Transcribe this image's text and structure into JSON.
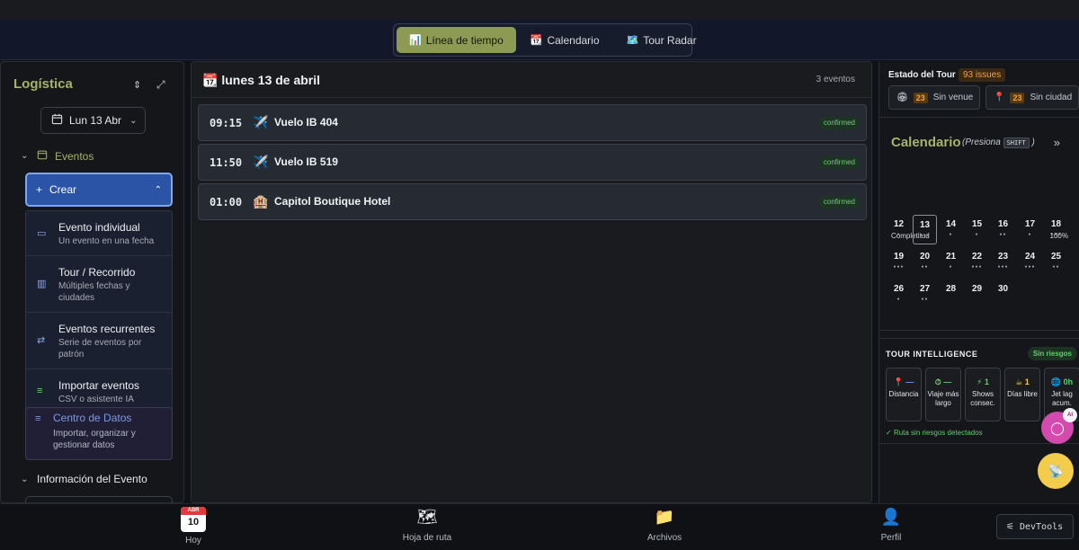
{
  "tabs": [
    {
      "icon": "📊",
      "label": "Línea de tiempo",
      "active": true
    },
    {
      "icon": "📆",
      "label": "Calendario",
      "active": false
    },
    {
      "icon": "🗺️",
      "label": "Tour Radar",
      "active": false
    }
  ],
  "left": {
    "title": "Logística",
    "date_label": "Lun 13 Abr",
    "events_section": "Eventos",
    "create_label": "Crear",
    "create_options": [
      {
        "label": "Evento individual",
        "desc": "Un evento en una fecha"
      },
      {
        "label": "Tour / Recorrido",
        "desc": "Múltiples fechas y ciudades"
      },
      {
        "label": "Eventos recurrentes",
        "desc": "Serie de eventos por patrón"
      },
      {
        "label": "Importar eventos",
        "desc": "CSV o asistente IA"
      }
    ],
    "data_center": {
      "label": "Centro de Datos",
      "desc": "Importar, organizar y gestionar datos"
    },
    "info_section": "Información del Evento"
  },
  "center": {
    "title": "📆 lunes 13 de abril",
    "count": "3 eventos",
    "events": [
      {
        "time": "09:15",
        "icon": "✈️",
        "name": "Vuelo IB 404",
        "status": "confirmed"
      },
      {
        "time": "11:50",
        "icon": "✈️",
        "name": "Vuelo IB 519",
        "status": "confirmed"
      },
      {
        "time": "01:00",
        "icon": "🏨",
        "name": "Capitol Boutique Hotel",
        "status": "confirmed"
      }
    ]
  },
  "right": {
    "estado_label": "Estado del Tour",
    "issues": "93 issues",
    "missing": [
      {
        "icon": "🏟",
        "count": "23",
        "label": "Sin venue"
      },
      {
        "icon": "📍",
        "count": "23",
        "label": "Sin ciudad"
      }
    ],
    "calendar": {
      "title": "Calendario",
      "hint_pre": "(Presiona",
      "hint_key": "SHIFT",
      "hint_post": ")",
      "completion_label": "Completitud",
      "completion_pct": "100%",
      "days": [
        {
          "n": "12",
          "dots": 1
        },
        {
          "n": "13",
          "dots": 3,
          "today": true
        },
        {
          "n": "14",
          "dots": 1
        },
        {
          "n": "15",
          "dots": 1
        },
        {
          "n": "16",
          "dots": 2
        },
        {
          "n": "17",
          "dots": 1
        },
        {
          "n": "18",
          "dots": 3
        },
        {
          "n": "19",
          "dots": 3
        },
        {
          "n": "20",
          "dots": 2
        },
        {
          "n": "21",
          "dots": 1
        },
        {
          "n": "22",
          "dots": 3
        },
        {
          "n": "23",
          "dots": 3
        },
        {
          "n": "24",
          "dots": 3
        },
        {
          "n": "25",
          "dots": 2
        },
        {
          "n": "26",
          "dots": 1
        },
        {
          "n": "27",
          "dots": 2
        },
        {
          "n": "28",
          "dots": 0
        },
        {
          "n": "29",
          "dots": 0
        },
        {
          "n": "30",
          "dots": 0
        }
      ]
    },
    "intel": {
      "title": "TOUR INTELLIGENCE",
      "badge": "Sin riesgos",
      "boxes": [
        {
          "icon": "📍",
          "value": "—",
          "label": "Distancia"
        },
        {
          "icon": "⏱",
          "value": "—",
          "label": "Viaje más largo"
        },
        {
          "icon": "⚡",
          "value": "1",
          "label": "Shows consec."
        },
        {
          "icon": "☕",
          "value": "1",
          "label": "Días libre"
        },
        {
          "icon": "🌐",
          "value": "0h",
          "label": "Jet lag acum."
        }
      ],
      "note": "Ruta sin riesgos detectados"
    }
  },
  "fab": {
    "ai_badge": "AI"
  },
  "bottomnav": {
    "items": [
      {
        "label": "Hoy",
        "cal_month": "ABR",
        "cal_day": "10"
      },
      {
        "label": "Hoja de ruta",
        "icon": "🗺"
      },
      {
        "label": "Archivos",
        "icon": "📁"
      },
      {
        "label": "Perfil",
        "icon": "👤"
      }
    ],
    "devtools": "DevTools"
  },
  "colors": {
    "accent": "#a7b36a",
    "active_tab": "#8c9a54",
    "create_button": "#2c54a6",
    "confirmed": "#6fcf74",
    "issues": "#f1a048"
  }
}
